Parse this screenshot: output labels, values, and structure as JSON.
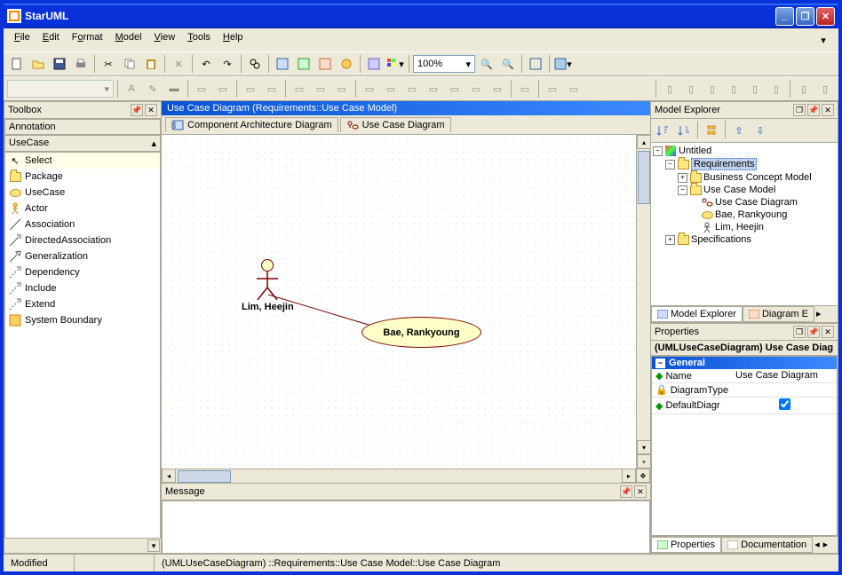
{
  "window": {
    "title": "StarUML"
  },
  "menu": {
    "file": "File",
    "edit": "Edit",
    "format": "Format",
    "model": "Model",
    "view": "View",
    "tools": "Tools",
    "help": "Help"
  },
  "zoom": {
    "value": "100%"
  },
  "toolbox": {
    "title": "Toolbox",
    "section_annotation": "Annotation",
    "section_usecase": "UseCase",
    "items": {
      "select": "Select",
      "package": "Package",
      "usecase": "UseCase",
      "actor": "Actor",
      "association": "Association",
      "directed": "DirectedAssociation",
      "generalization": "Generalization",
      "dependency": "Dependency",
      "include": "Include",
      "extend": "Extend",
      "boundary": "System Boundary"
    }
  },
  "diagram": {
    "title": "Use Case Diagram (Requirements::Use Case Model)",
    "tabs": {
      "component": "Component Architecture Diagram",
      "usecase": "Use Case Diagram"
    },
    "actor_label": "Lim, Heejin",
    "usecase_label": "Bae, Rankyoung"
  },
  "explorer": {
    "title": "Model Explorer",
    "root": "Untitled",
    "requirements": "Requirements",
    "bcm": "Business Concept Model",
    "ucm": "Use Case Model",
    "ucd": "Use Case Diagram",
    "bae": "Bae, Rankyoung",
    "lim": "Lim, Heejin",
    "spec": "Specifications",
    "tab_model": "Model Explorer",
    "tab_diagram": "Diagram E"
  },
  "properties": {
    "title": "Properties",
    "type": "(UMLUseCaseDiagram) Use Case Diag",
    "group": "General",
    "name_label": "Name",
    "name_value": "Use Case Diagram",
    "diagtype_label": "DiagramType",
    "default_label": "DefaultDiagr",
    "tab_props": "Properties",
    "tab_docs": "Documentation"
  },
  "message": {
    "title": "Message"
  },
  "statusbar": {
    "modified": "Modified",
    "path": "(UMLUseCaseDiagram) ::Requirements::Use Case Model::Use Case Diagram"
  }
}
